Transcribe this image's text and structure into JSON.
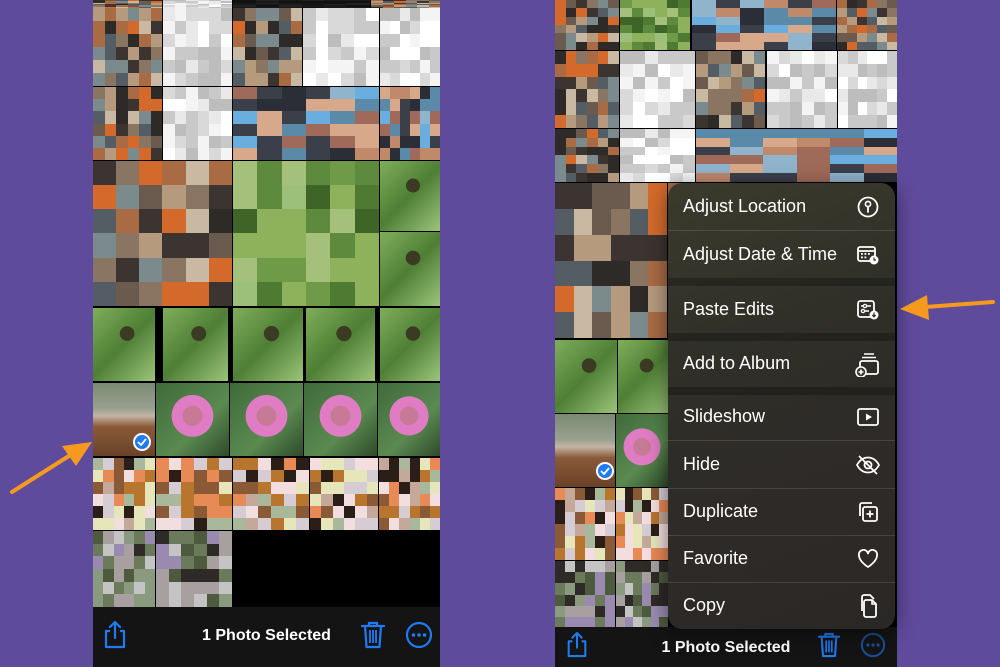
{
  "background_color": "#5f4b9b",
  "accent_color": "#1f7bf2",
  "arrow_color": "#f59a1f",
  "left_screen": {
    "toolbar": {
      "title": "1 Photo Selected",
      "share_icon": "share-icon",
      "delete_icon": "trash-icon",
      "more_icon": "ellipsis-circle-icon"
    },
    "selected_photo": "lego-figure-on-wood",
    "selection_badge": "checkmark-icon"
  },
  "right_screen": {
    "toolbar": {
      "title": "1 Photo Selected",
      "share_icon": "share-icon",
      "delete_icon": "trash-icon",
      "more_icon": "ellipsis-circle-icon"
    },
    "context_menu": {
      "items": [
        {
          "label": "Adjust Location",
          "icon": "location-pin-circle-icon"
        },
        {
          "label": "Adjust Date & Time",
          "icon": "calendar-clock-icon"
        },
        {
          "label": "Paste Edits",
          "icon": "paste-edits-icon"
        },
        {
          "label": "Add to Album",
          "icon": "add-to-album-icon"
        },
        {
          "label": "Slideshow",
          "icon": "play-rectangle-icon"
        },
        {
          "label": "Hide",
          "icon": "eye-slash-icon"
        },
        {
          "label": "Duplicate",
          "icon": "duplicate-icon"
        },
        {
          "label": "Favorite",
          "icon": "heart-icon"
        },
        {
          "label": "Copy",
          "icon": "copy-icon"
        }
      ]
    }
  },
  "annotations": [
    {
      "type": "arrow",
      "points_to": "selected-photo",
      "color": "#f59a1f"
    },
    {
      "type": "arrow",
      "points_to": "Paste Edits",
      "color": "#f59a1f"
    }
  ]
}
